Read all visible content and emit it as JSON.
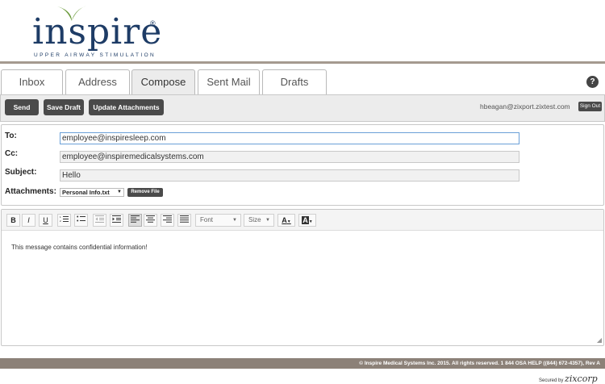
{
  "brand": {
    "logo_word": "inspire",
    "logo_tagline": "UPPER AIRWAY STIMULATION",
    "reg_mark": "®",
    "brand_color": "#1e3c66",
    "leaf_color": "#6a9a3a"
  },
  "tabs": [
    {
      "label": "Inbox"
    },
    {
      "label": "Address"
    },
    {
      "label": "Compose",
      "active": true
    },
    {
      "label": "Sent Mail"
    },
    {
      "label": "Drafts"
    }
  ],
  "help_icon": {
    "glyph": "?"
  },
  "toolbar": {
    "send_label": "Send",
    "save_draft_label": "Save Draft",
    "update_attachments_label": "Update Attachments",
    "user_email": "hbeagan@zixport.zixtest.com",
    "sign_out_label": "Sign Out"
  },
  "compose": {
    "to_label": "To:",
    "to_value": "employee@inspiresleep.com",
    "cc_label": "Cc:",
    "cc_value": "employee@inspiremedicalsystems.com",
    "subject_label": "Subject:",
    "subject_value": "Hello",
    "attachments_label": "Attachments:",
    "attachment_selected": "Personal Info.txt",
    "remove_file_label": "Remove File"
  },
  "editor": {
    "toolbar": {
      "bold": "B",
      "italic": "I",
      "underline": "U",
      "font_label": "Font",
      "size_label": "Size",
      "font_color_glyph": "A",
      "bg_color_glyph": "A"
    },
    "body_text": "This message contains confidential information!"
  },
  "footer": {
    "copyright": "© Inspire Medical Systems Inc. 2015. All rights reserved. 1 844 OSA HELP ((844) 672-4357), Rev A",
    "secured_by": "Secured by",
    "zix_logo": "zixcorp"
  },
  "colors": {
    "button_dark": "#4a4a4a",
    "footer_bar": "#8c8178",
    "top_rule": "#a59a8f"
  }
}
